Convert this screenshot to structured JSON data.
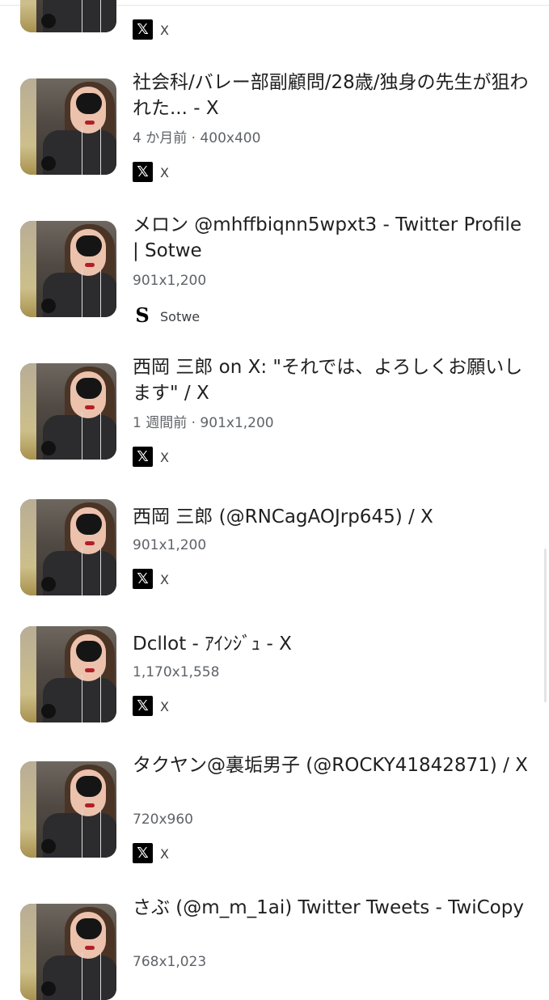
{
  "results": [
    {
      "title": "",
      "meta": "",
      "source": "X",
      "source_icon": "x-logo-icon"
    },
    {
      "title": "社会科/バレー部副顧問/28歳/独身の先生が狙われた... - X",
      "meta": "4 か月前 · 400x400",
      "source": "X",
      "source_icon": "x-logo-icon"
    },
    {
      "title": "メロン @mhffbiqnn5wpxt3 - Twitter Profile | Sotwe",
      "meta": "901x1,200",
      "source": "Sotwe",
      "source_icon": "sotwe-logo-icon"
    },
    {
      "title": "西岡 三郎 on X: \"それでは、よろしくお願いします\" / X",
      "meta": "1 週間前 · 901x1,200",
      "source": "X",
      "source_icon": "x-logo-icon"
    },
    {
      "title": "西岡 三郎 (@RNCagAOJrp645) / X",
      "meta": "901x1,200",
      "source": "X",
      "source_icon": "x-logo-icon"
    },
    {
      "title": "Dcllot - ｱｲﾝｼﾞｭ - X",
      "meta": "1,170x1,558",
      "source": "X",
      "source_icon": "x-logo-icon"
    },
    {
      "title": "タクヤン@裏垢男子 (@ROCKY41842871) / X",
      "meta": "720x960",
      "source": "X",
      "source_icon": "x-logo-icon"
    },
    {
      "title": "さぶ (@m_m_1ai) Twitter Tweets - TwiCopy",
      "meta": "768x1,023",
      "source": "",
      "source_icon": ""
    }
  ],
  "icons": {
    "x_glyph": "𝕏",
    "sotwe_glyph": "S"
  }
}
